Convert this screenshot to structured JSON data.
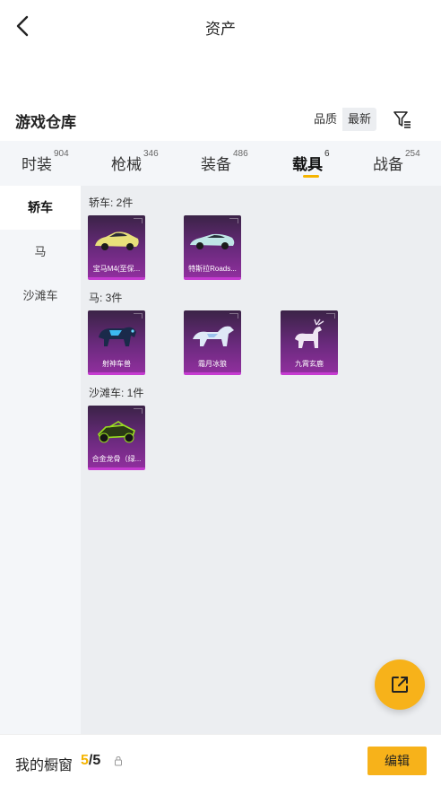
{
  "header": {
    "title": "资产",
    "back_icon": "chevron-left-icon"
  },
  "warehouse": {
    "title": "游戏仓库",
    "sort_options": [
      "品质",
      "最新"
    ],
    "filter_icon": "filter-icon"
  },
  "tabs": [
    {
      "label": "时装",
      "count": "904",
      "active": false
    },
    {
      "label": "枪械",
      "count": "346",
      "active": false
    },
    {
      "label": "装备",
      "count": "486",
      "active": false
    },
    {
      "label": "载具",
      "count": "6",
      "active": true
    },
    {
      "label": "战备",
      "count": "254",
      "active": false
    }
  ],
  "sidebar": {
    "items": [
      {
        "label": "轿车",
        "active": true
      },
      {
        "label": "马",
        "active": false
      },
      {
        "label": "沙滩车",
        "active": false
      }
    ]
  },
  "groups": [
    {
      "label": "轿车: 2件",
      "items": [
        {
          "name": "宝马M4(至保...",
          "icon": "yellow-sports-car"
        },
        {
          "name": "特斯拉Roads...",
          "icon": "teal-roadster-car"
        }
      ]
    },
    {
      "label": "马: 3件",
      "items": [
        {
          "name": "射神车兽",
          "icon": "blue-beast-mount"
        },
        {
          "name": "霜月冰狼",
          "icon": "ice-wolf-mount"
        },
        {
          "name": "九霄玄鹿",
          "icon": "white-deer-mount"
        }
      ]
    },
    {
      "label": "沙滩车: 1件",
      "items": [
        {
          "name": "合金龙骨（绿...",
          "icon": "green-buggy"
        }
      ]
    }
  ],
  "fab": {
    "icon": "share-external-icon"
  },
  "footer": {
    "showcase_label": "我的橱窗",
    "count_current": "5",
    "count_sep": "/",
    "count_total": "5",
    "lock_icon": "lock-icon",
    "edit_label": "编辑"
  },
  "colors": {
    "accent": "#f7b21a",
    "card_purple": "#8f2f9d",
    "card_border": "#c53bd0",
    "panel_bg": "#eceef1"
  }
}
